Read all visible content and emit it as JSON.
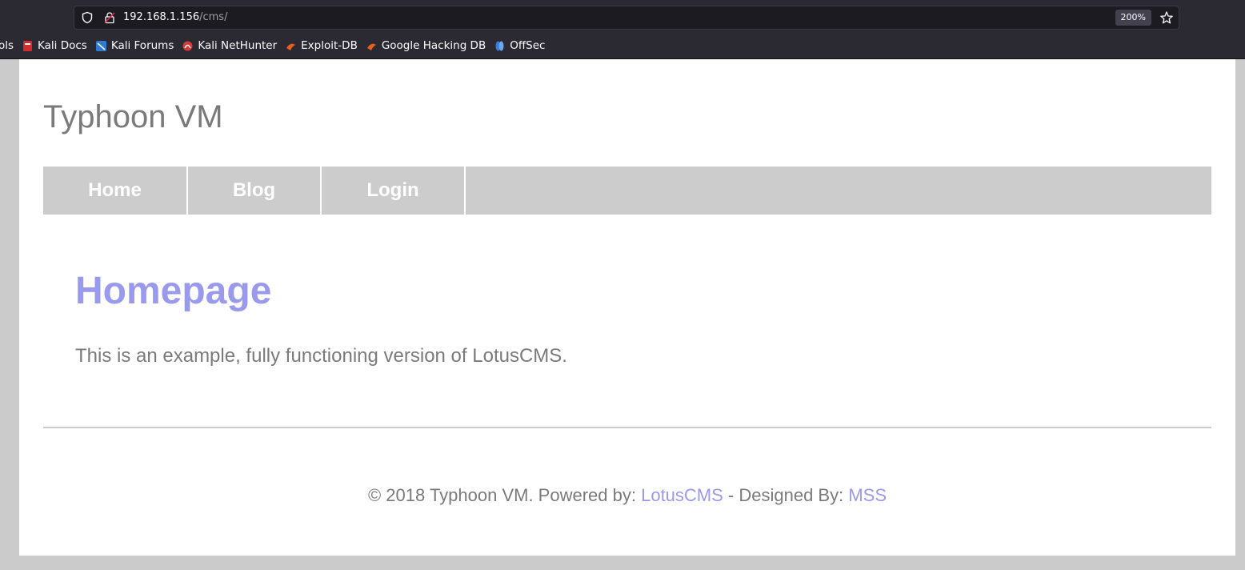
{
  "browser": {
    "url_host": "192.168.1.156",
    "url_path": "/cms/",
    "zoom": "200%",
    "bookmarks": [
      {
        "label": "ols",
        "icon": "truncated-icon"
      },
      {
        "label": "Kali Docs",
        "icon": "kali-docs-icon"
      },
      {
        "label": "Kali Forums",
        "icon": "kali-forums-icon"
      },
      {
        "label": "Kali NetHunter",
        "icon": "kali-nethunter-icon"
      },
      {
        "label": "Exploit-DB",
        "icon": "exploit-db-icon"
      },
      {
        "label": "Google Hacking DB",
        "icon": "ghdb-icon"
      },
      {
        "label": "OffSec",
        "icon": "offsec-icon"
      }
    ]
  },
  "site": {
    "title": "Typhoon VM",
    "nav": [
      "Home",
      "Blog",
      "Login"
    ]
  },
  "content": {
    "heading": "Homepage",
    "text": "This is an example, fully functioning version of LotusCMS."
  },
  "footer": {
    "prefix": "© 2018 Typhoon VM. Powered by: ",
    "powered_link": "LotusCMS",
    "middle": " - Designed By: ",
    "designer_link": "MSS"
  },
  "colors": {
    "link": "#9999ee",
    "text": "#7a7a7a",
    "nav_bg": "#cccccc",
    "chrome_bg": "#2b2a33"
  }
}
